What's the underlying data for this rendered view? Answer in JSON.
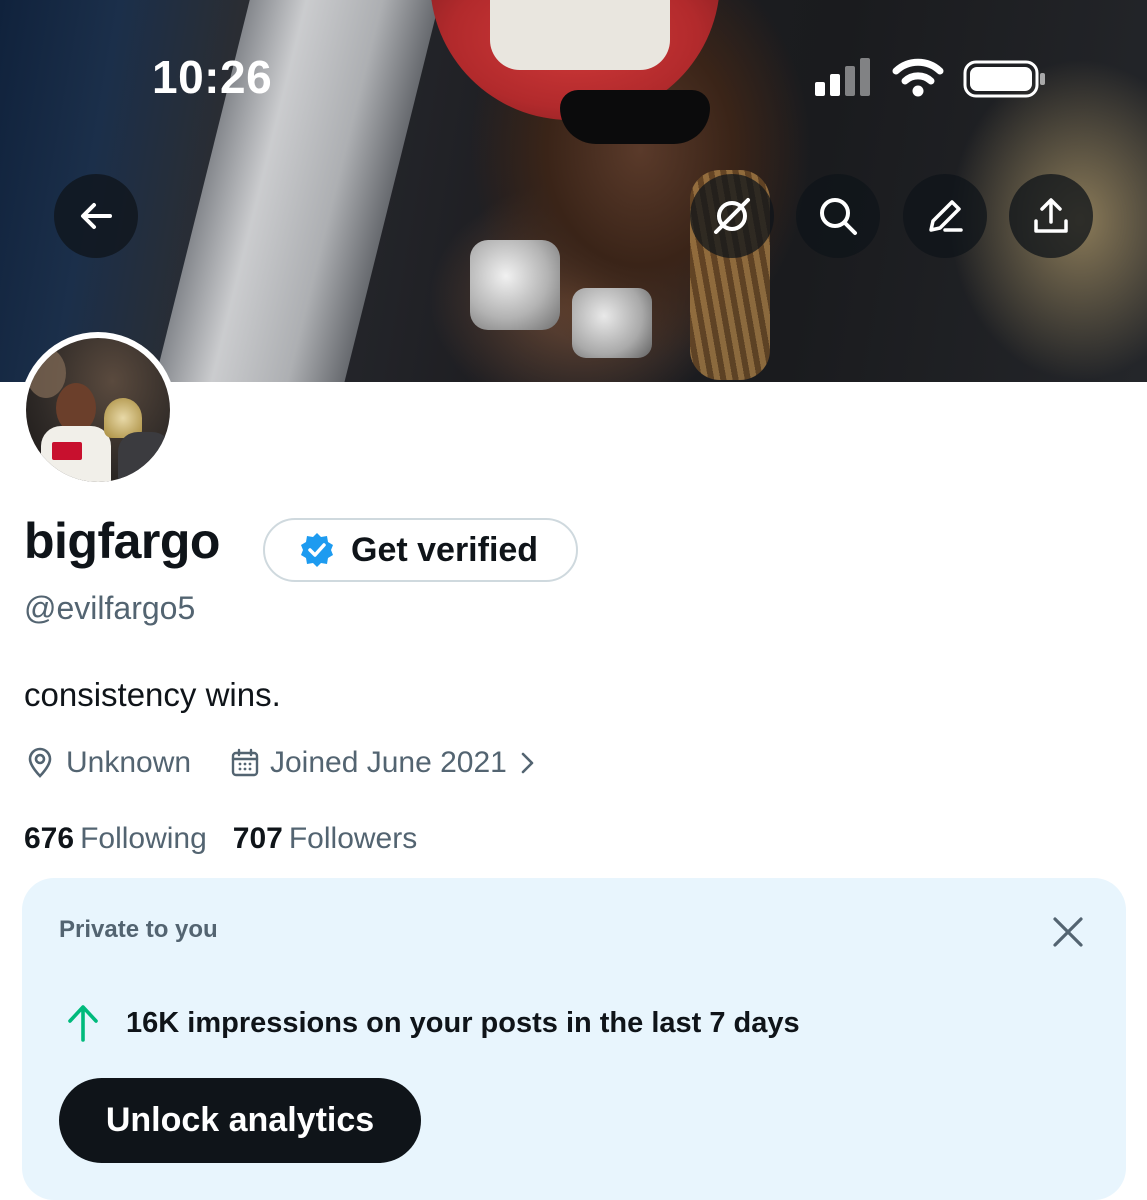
{
  "status_bar": {
    "time": "10:26",
    "signal_bars": 2,
    "signal_bars_total": 4,
    "icons": [
      "cellular-signal-icon",
      "wifi-icon",
      "battery-icon"
    ]
  },
  "header_actions": {
    "back_icon": "arrow-left-icon",
    "icons": [
      "grok-icon",
      "search-icon",
      "edit-pencil-icon",
      "share-upload-icon"
    ]
  },
  "profile": {
    "display_name": "bigfargo",
    "get_verified_label": "Get verified",
    "handle": "@evilfargo5",
    "bio": "consistency wins.",
    "location": "Unknown",
    "joined": "Joined June 2021",
    "following_count": "676",
    "following_label": "Following",
    "followers_count": "707",
    "followers_label": "Followers"
  },
  "private_card": {
    "title": "Private to you",
    "impressions_text": "16K impressions on your posts in the last 7 days",
    "unlock_label": "Unlock analytics",
    "trend": "up"
  },
  "colors": {
    "verified_blue": "#1d9bf0",
    "trend_green": "#00ba7c",
    "card_bg": "#e8f5fd",
    "text_secondary": "#536471"
  }
}
